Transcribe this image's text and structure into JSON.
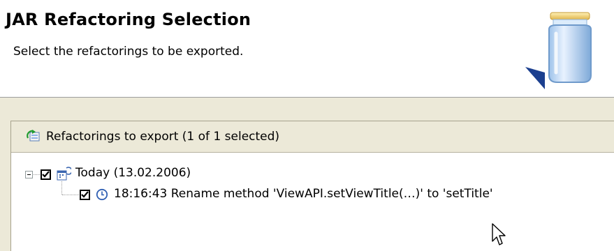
{
  "header": {
    "title": "JAR Refactoring Selection",
    "description": "Select the refactorings to be exported."
  },
  "panel": {
    "title": "Refactorings to export (1 of 1 selected)"
  },
  "tree": {
    "items": [
      {
        "label": "Today (13.02.2006)",
        "checked": true,
        "expanded": true,
        "icon": "calendar-history-icon"
      },
      {
        "label": "18:16:43 Rename method 'ViewAPI.setViewTitle(…)' to 'setTitle'",
        "checked": true,
        "icon": "clock-icon"
      }
    ]
  },
  "colors": {
    "dialog_bg": "#ece9d8",
    "header_bg": "#ffffff",
    "accent": "#2f5fb3"
  }
}
